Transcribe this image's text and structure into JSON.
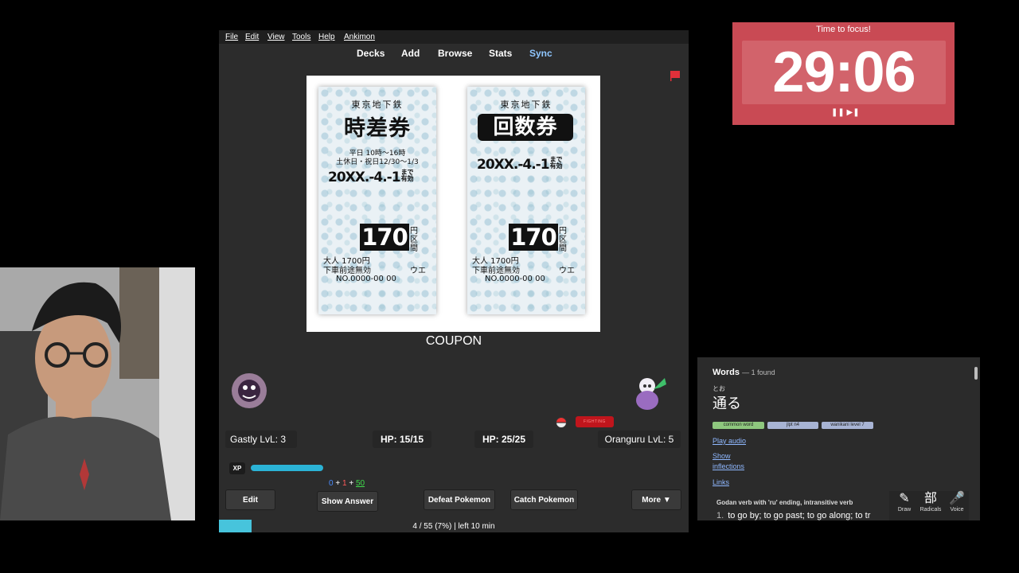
{
  "menu": [
    "File",
    "Edit",
    "View",
    "Tools",
    "Help",
    "Ankimon"
  ],
  "toplinks": {
    "decks": "Decks",
    "add": "Add",
    "browse": "Browse",
    "stats": "Stats",
    "sync": "Sync"
  },
  "card": {
    "ticket_left": {
      "line1": "東京地下鉄",
      "title": "時差券",
      "small1": "平日 10時〜16時",
      "small2": "土休日・祝日12/30〜1/3",
      "date": "20XX.-4.-1",
      "date_suffix": "まで有効",
      "price": "170",
      "price_unit": "円区間",
      "bottom1": "大人 1700円",
      "bottom2": "下車前途無効",
      "bottom2_right": "ウエ",
      "bottom3": "NO.0000-00 00"
    },
    "ticket_right": {
      "line1": "東京地下鉄",
      "title": "回数券",
      "date": "20XX.-4.-1",
      "date_suffix": "まで有効",
      "price": "170",
      "price_unit": "円区間",
      "bottom1": "大人 1700円",
      "bottom2": "下車前途無効",
      "bottom2_right": "ウエ",
      "bottom3": "NO.0000-00 00"
    },
    "answer": "COUPON"
  },
  "battle": {
    "badge": "FIGHTING",
    "player": {
      "name_level": "Gastly LvL: 3",
      "hp": "HP: 15/15"
    },
    "enemy": {
      "name_level": "Oranguru LvL: 5",
      "hp": "HP: 25/25"
    },
    "xp_label": "XP",
    "xp_progress": 0.35
  },
  "counts": {
    "new": "0",
    "learn": "1",
    "review": "50"
  },
  "buttons": {
    "edit": "Edit",
    "show_answer": "Show Answer",
    "defeat": "Defeat Pokemon",
    "catch": "Catch Pokemon",
    "more": "More ▼"
  },
  "progress": {
    "text": "4 / 55 (7%) | left 10 min",
    "fraction": 0.07
  },
  "timer": {
    "title": "Time to focus!",
    "time": "29:06",
    "controls": "❚❚ ▶❚"
  },
  "dictionary": {
    "header": "Words",
    "found": "— 1 found",
    "furigana": "とお",
    "word": "通る",
    "tags": [
      "common word",
      "jlpt n4",
      "wanikani level 7"
    ],
    "play_audio": "Play audio",
    "show": "Show",
    "inflections": "inflections",
    "links": "Links",
    "pos": "Godan verb with 'ru' ending, intransitive verb",
    "def_num": "1.",
    "definition": "to go by; to go past; to go along; to tr",
    "tools": [
      {
        "icon": "✎",
        "label": "Draw"
      },
      {
        "icon": "部",
        "label": "Radicals"
      },
      {
        "icon": "🎤",
        "label": "Voice"
      }
    ]
  }
}
